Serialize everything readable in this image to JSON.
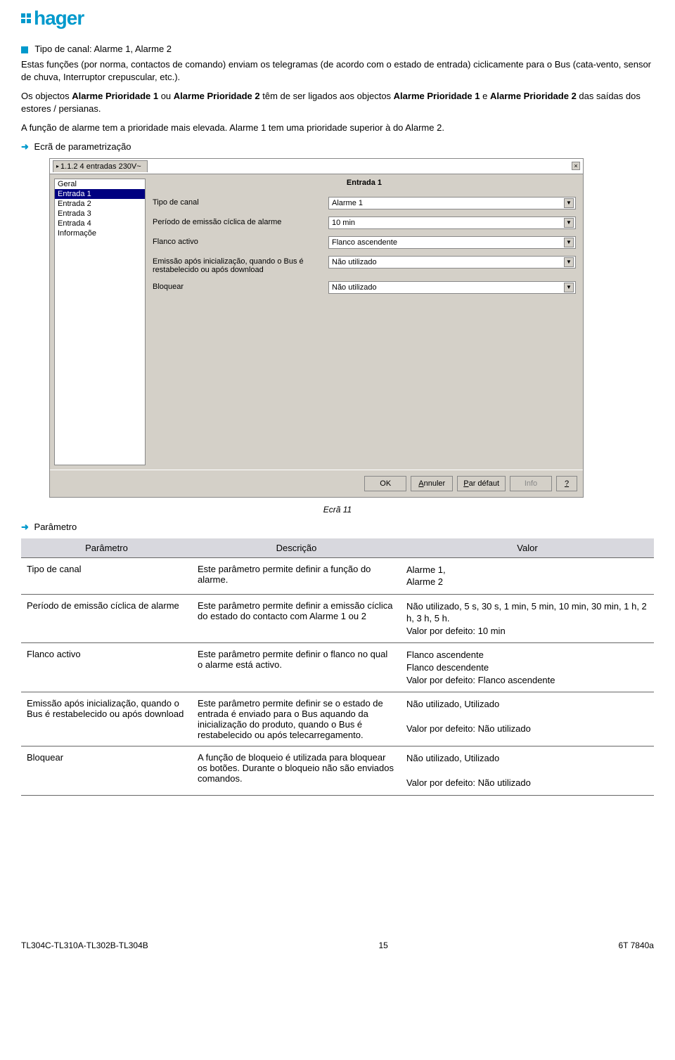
{
  "logo": {
    "text": "hager"
  },
  "section": {
    "title": "Tipo de canal: Alarme 1, Alarme 2",
    "para1": "Estas funções (por norma, contactos de comando) enviam os telegramas (de acordo com o estado de entrada) ciclicamente para o Bus (cata-vento, sensor de chuva, Interruptor crepuscular, etc.).",
    "para2a": "Os objectos ",
    "para2b": "Alarme Prioridade 1",
    "para2c": " ou ",
    "para2d": "Alarme Prioridade 2",
    "para2e": " têm de ser ligados aos objectos ",
    "para2f": "Alarme Prioridade 1",
    "para2g": " e ",
    "para2h": "Alarme Prioridade 2",
    "para2i": " das saídas dos estores / persianas.",
    "para3": "A função de alarme tem a prioridade mais elevada. Alarme 1 tem uma prioridade superior à do Alarme 2."
  },
  "sub1": "Ecrã de parametrização",
  "dialog": {
    "tabLabel": "1.1.2 4 entradas 230V~",
    "sidebar": [
      "Geral",
      "Entrada 1",
      "Entrada 2",
      "Entrada 3",
      "Entrada 4",
      "Informaçõe"
    ],
    "selectedIndex": 1,
    "mainTitle": "Entrada 1",
    "rows": [
      {
        "label": "Tipo de canal",
        "value": "Alarme 1"
      },
      {
        "label": "Período de emissão cíclica de alarme",
        "value": "10 min"
      },
      {
        "label": "Flanco activo",
        "value": "Flanco ascendente"
      },
      {
        "label": "Emissão após inicialização, quando o Bus é restabelecido ou após download",
        "value": "Não utilizado"
      },
      {
        "label": "Bloquear",
        "value": "Não utilizado"
      }
    ],
    "buttons": {
      "ok": "OK",
      "cancel": "Annuler",
      "default": "Par défaut",
      "info": "Info",
      "help": "?"
    }
  },
  "caption": "Ecrã 11",
  "sub2": "Parâmetro",
  "table": {
    "headers": [
      "Parâmetro",
      "Descrição",
      "Valor"
    ],
    "rows": [
      {
        "p": "Tipo de canal",
        "d": "Este parâmetro permite definir a função do alarme.",
        "v": "Alarme 1,\nAlarme 2"
      },
      {
        "p": "Período de emissão cíclica de alarme",
        "d": "Este parâmetro permite definir a emissão cíclica do estado do contacto com Alarme 1 ou 2",
        "v": "Não utilizado, 5 s, 30 s, 1 min, 5 min, 10 min, 30 min, 1 h, 2 h, 3 h, 5 h.\nValor por defeito: 10 min"
      },
      {
        "p": "Flanco activo",
        "d": "Este parâmetro permite definir o flanco no qual o alarme está activo.",
        "v": "Flanco ascendente\nFlanco descendente\nValor por defeito: Flanco ascendente"
      },
      {
        "p": "Emissão após inicialização, quando o Bus é restabelecido ou após download",
        "d": "Este parâmetro permite definir se o estado de entrada é enviado para o Bus aquando da inicialização do produto, quando o Bus é restabelecido ou após telecarregamento.",
        "v": "Não utilizado, Utilizado\n\nValor por defeito: Não utilizado"
      },
      {
        "p": "Bloquear",
        "d": "A função de bloqueio é utilizada para bloquear os botões. Durante o bloqueio não são enviados comandos.",
        "v": "Não utilizado, Utilizado\n\nValor por defeito: Não utilizado"
      }
    ]
  },
  "footer": {
    "left": "TL304C-TL310A-TL302B-TL304B",
    "center": "15",
    "right": "6T 7840a"
  }
}
